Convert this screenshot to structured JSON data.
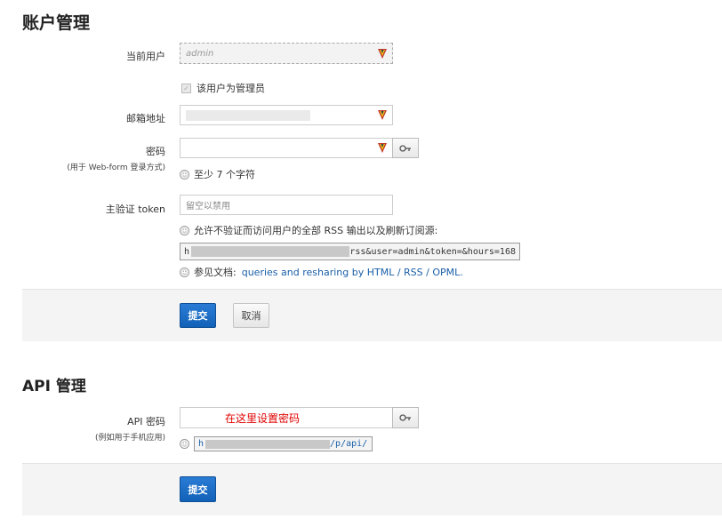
{
  "account": {
    "title": "账户管理",
    "current_user_label": "当前用户",
    "current_user_value": "admin",
    "is_admin_label": "该用户为管理员",
    "email_label": "邮箱地址",
    "password_label": "密码",
    "password_sublabel": "(用于 Web-form 登录方式)",
    "password_hint": "至少 7 个字符",
    "token_label": "主验证 token",
    "token_placeholder": "留空以禁用",
    "token_hint": "允许不验证而访问用户的全部 RSS 输出以及刷新订阅源:",
    "token_url_prefix": "h",
    "token_url_suffix": "rss&user=admin&token=&hours=168",
    "docs_prefix": "参见文档:",
    "docs_link": "queries and resharing by HTML / RSS / OPML",
    "docs_suffix": ".",
    "submit_label": "提交",
    "cancel_label": "取消"
  },
  "api": {
    "title": "API 管理",
    "password_label": "API 密码",
    "password_sublabel": "(例如用于手机应用)",
    "password_annotation": "在这里设置密码",
    "api_url_prefix": "h",
    "api_url_suffix": "/p/api/",
    "submit_label": "提交"
  },
  "icons": {
    "password_manager": "password-manager-icon",
    "key": "key-icon",
    "info": "info-icon"
  },
  "colors": {
    "primary": "#1a6bc4",
    "link": "#1a5fa8",
    "annotation": "#e00000"
  }
}
